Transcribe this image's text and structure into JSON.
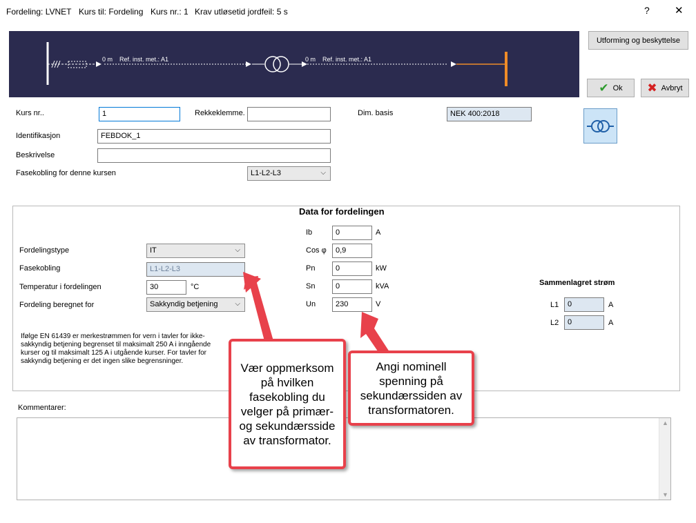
{
  "titlebar": {
    "title": "Fordeling: LVNET",
    "kurs_til": "Kurs til: Fordeling",
    "kurs_nr": "Kurs nr.: 1",
    "krav": "Krav utløsetid jordfeil: 5 s",
    "help": "?",
    "close": "✕"
  },
  "diagram": {
    "bg_color": "#2b2b4f",
    "left_length": "0 m",
    "left_ref": "Ref. inst. met.: A1",
    "right_length": "0 m",
    "right_ref": "Ref. inst. met.: A1",
    "accent": "#f08c28"
  },
  "buttons": {
    "utforming": "Utforming og beskyttelse",
    "ok": "Ok",
    "avbryt": "Avbryt"
  },
  "form": {
    "kurs_nr_label": "Kurs nr..",
    "kurs_nr_value": "1",
    "rekkeklemme_label": "Rekkeklemme.",
    "rekkeklemme_value": "",
    "dim_basis_label": "Dim. basis",
    "dim_basis_value": "NEK 400:2018",
    "identifikasjon_label": "Identifikasjon",
    "identifikasjon_value": "FEBDOK_1",
    "beskrivelse_label": "Beskrivelse",
    "beskrivelse_value": "",
    "fasekobling_label": "Fasekobling for denne kursen",
    "fasekobling_value": "L1-L2-L3"
  },
  "data_section": {
    "title": "Data for fordelingen",
    "fordelingstype_label": "Fordelingstype",
    "fordelingstype_value": "IT",
    "fasekobling_label": "Fasekobling",
    "fasekobling_value": "L1-L2-L3",
    "temperatur_label": "Temperatur i fordelingen",
    "temperatur_value": "30",
    "temperatur_unit": "°C",
    "beregnet_label": "Fordeling beregnet for",
    "beregnet_value": "Sakkyndig betjening",
    "info_text": "Ifølge EN 61439 er merkestrømmen for vern i tavler for ikke-sakkyndig betjening begrenset til maksimalt 250 A i inngående kurser og til maksimalt 125 A i utgående kurser. For tavler for sakkyndig betjening er det ingen slike begrensninger.",
    "ib_label": "Ib",
    "ib_value": "0",
    "ib_unit": "A",
    "cos_label": "Cos φ",
    "cos_value": "0,9",
    "pn_label": "Pn",
    "pn_value": "0",
    "pn_unit": "kW",
    "sn_label": "Sn",
    "sn_value": "0",
    "sn_unit": "kVA",
    "un_label": "Un",
    "un_value": "230",
    "un_unit": "V",
    "sammenlagret_title": "Sammenlagret strøm",
    "l1_label": "L1",
    "l1_value": "0",
    "l1_unit": "A",
    "l2_label": "L2",
    "l2_value": "0",
    "l2_unit": "A"
  },
  "kommentarer": {
    "label": "Kommentarer:",
    "value": ""
  },
  "callouts": {
    "left": "Vær oppmerksom på hvilken fasekobling du velger på primær- og sekundærsside av transformator.",
    "right": "Angi nominell spenning på sekundærssiden av transformatoren."
  },
  "colors": {
    "callout_border": "#e8414b",
    "readonly_bg": "#dde7f1",
    "ok_green": "#2e9b2e",
    "cancel_red": "#d42020"
  }
}
